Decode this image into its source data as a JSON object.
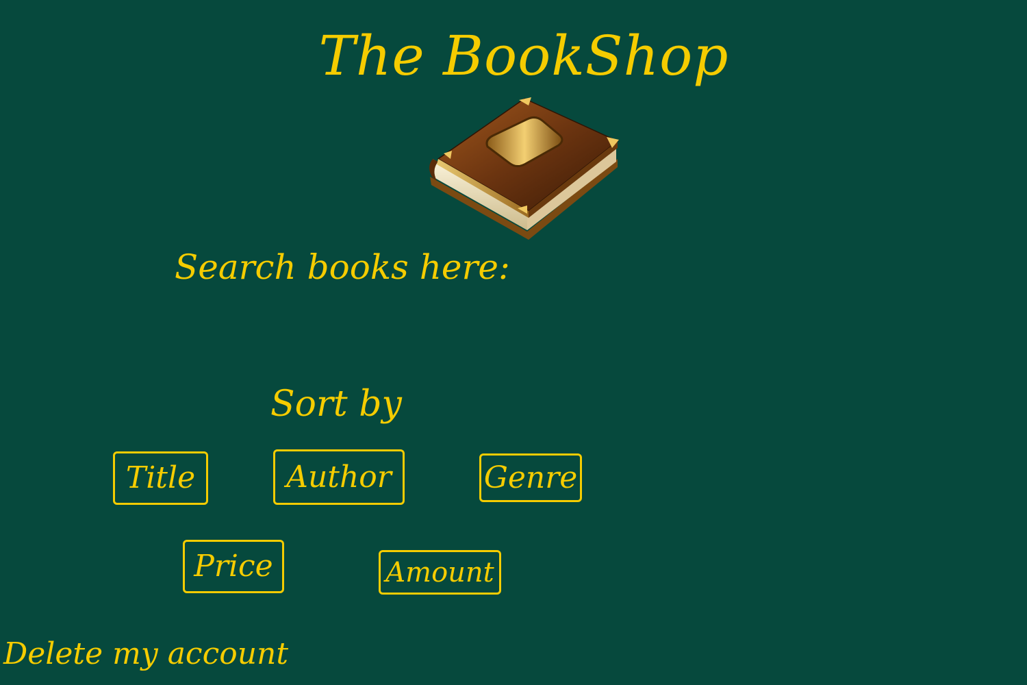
{
  "header": {
    "title": "The BookShop",
    "logo_icon": "book-icon"
  },
  "search": {
    "label": "Search books here:"
  },
  "sort": {
    "label": "Sort by",
    "buttons": {
      "title": "Title",
      "author": "Author",
      "genre": "Genre",
      "price": "Price",
      "amount": "Amount"
    }
  },
  "footer": {
    "delete_account": "Delete my account"
  },
  "colors": {
    "background": "#06493d",
    "accent": "#f5cc00"
  }
}
